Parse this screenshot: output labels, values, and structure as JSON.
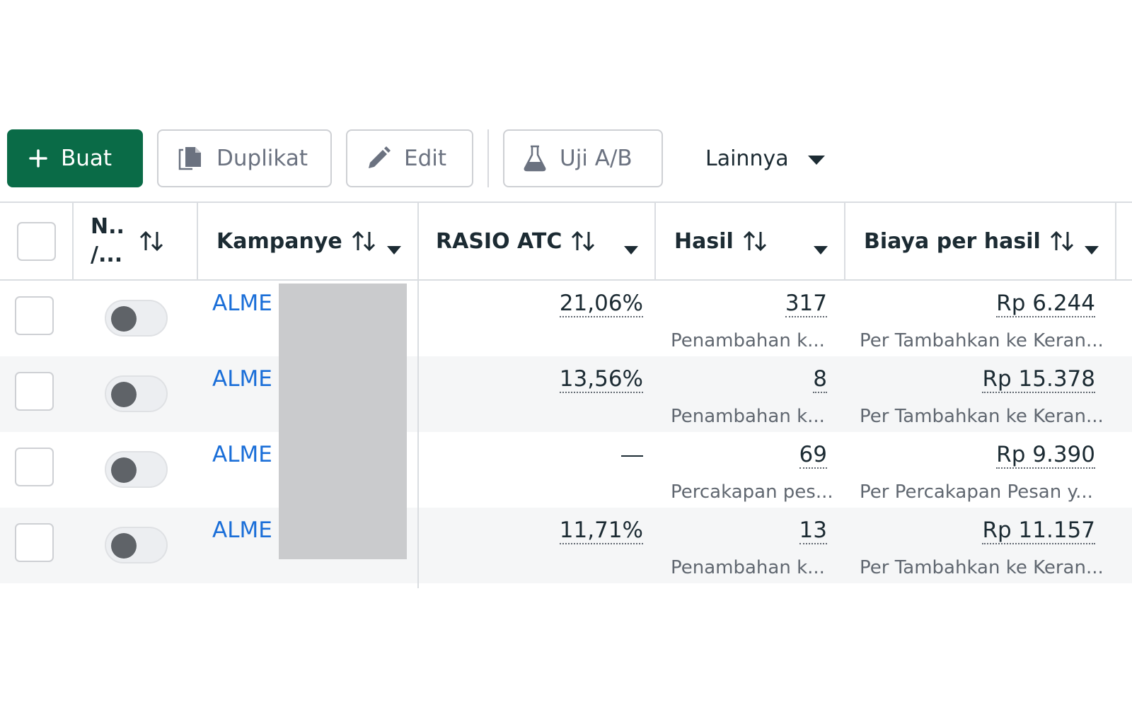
{
  "toolbar": {
    "create_label": "Buat",
    "duplicate_label": "Duplikat",
    "edit_label": "Edit",
    "ab_test_label": "Uji A/B",
    "more_label": "Lainnya"
  },
  "columns": {
    "status_line1": "N..",
    "status_line2": "/...",
    "campaign": "Kampanye",
    "atc_ratio": "RASIO ATC",
    "results": "Hasil",
    "cost_per_result": "Biaya per hasil"
  },
  "rows": [
    {
      "campaign": "ALME",
      "atc_ratio": "21,06%",
      "results": "317",
      "results_sub": "Penambahan k...",
      "cost": "Rp 6.244",
      "cost_sub": "Per Tambahkan ke Keran..."
    },
    {
      "campaign": "ALME",
      "atc_ratio": "13,56%",
      "results": "8",
      "results_sub": "Penambahan k...",
      "cost": "Rp 15.378",
      "cost_sub": "Per Tambahkan ke Keran..."
    },
    {
      "campaign": "ALME",
      "atc_ratio": "—",
      "results": "69",
      "results_sub": "Percakapan pes...",
      "cost": "Rp 9.390",
      "cost_sub": "Per Percakapan Pesan y..."
    },
    {
      "campaign": "ALME",
      "atc_ratio": "11,71%",
      "results": "13",
      "results_sub": "Penambahan k...",
      "cost": "Rp 11.157",
      "cost_sub": "Per Tambahkan ke Keran..."
    }
  ]
}
